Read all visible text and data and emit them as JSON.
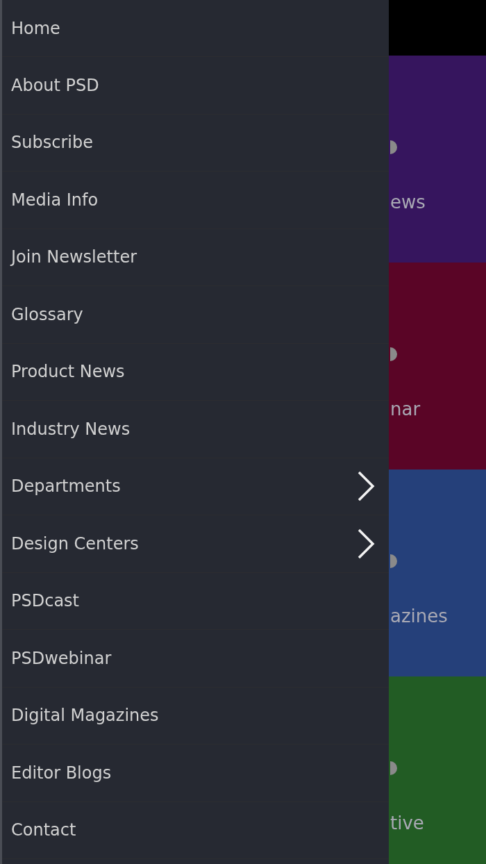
{
  "menu": {
    "items": [
      {
        "label": "Home",
        "has_submenu": false
      },
      {
        "label": "About PSD",
        "has_submenu": false
      },
      {
        "label": "Subscribe",
        "has_submenu": false
      },
      {
        "label": "Media Info",
        "has_submenu": false
      },
      {
        "label": "Join Newsletter",
        "has_submenu": false
      },
      {
        "label": "Glossary",
        "has_submenu": false
      },
      {
        "label": "Product News",
        "has_submenu": false
      },
      {
        "label": "Industry News",
        "has_submenu": false
      },
      {
        "label": "Departments",
        "has_submenu": true
      },
      {
        "label": "Design Centers",
        "has_submenu": true
      },
      {
        "label": "PSDcast",
        "has_submenu": false
      },
      {
        "label": "PSDwebinar",
        "has_submenu": false
      },
      {
        "label": "Digital Magazines",
        "has_submenu": false
      },
      {
        "label": "Editor Blogs",
        "has_submenu": false
      },
      {
        "label": "Contact",
        "has_submenu": false
      }
    ]
  },
  "tiles": [
    {
      "label": "ews",
      "color": "#36155e"
    },
    {
      "label": "nar",
      "color": "#5a0526"
    },
    {
      "label": "azines",
      "color": "#25407a"
    },
    {
      "label": "tive",
      "color": "#225c24"
    }
  ]
}
